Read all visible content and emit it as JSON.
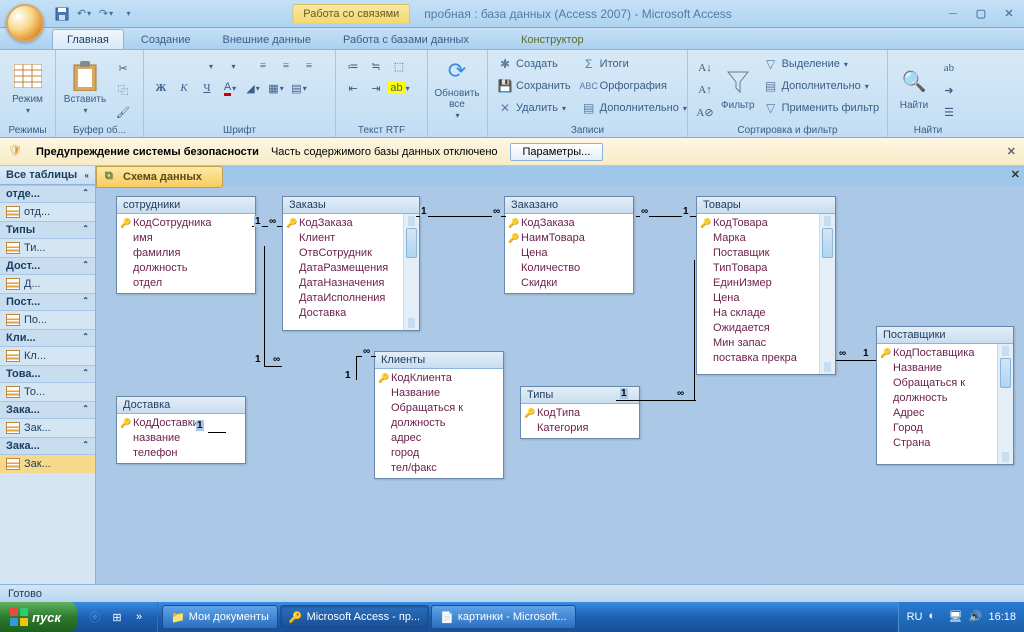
{
  "title": {
    "context_tab": "Работа со связями",
    "app": "пробная : база данных (Access 2007) - Microsoft Access"
  },
  "ribbon_tabs": [
    "Главная",
    "Создание",
    "Внешние данные",
    "Работа с базами данных",
    "Конструктор"
  ],
  "ribbon": {
    "groups": {
      "rezhimy": "Режимы",
      "bufer": "Буфер об...",
      "shrift": "Шрифт",
      "text_rtf": "Текст RTF",
      "zapisi_lbl": "Записи",
      "sort_filter": "Сортировка и фильтр",
      "nayti_lbl": "Найти"
    },
    "rezhim": "Режим",
    "vstavit": "Вставить",
    "obnovit": "Обновить\nвсе",
    "zapisi": {
      "sozdat": "Создать",
      "sokhranit": "Сохранить",
      "udalit": "Удалить",
      "itogi": "Итоги",
      "orfografiya": "Орфография",
      "dop": "Дополнительно"
    },
    "sort": {
      "filtr": "Фильтр",
      "vydelenie": "Выделение",
      "dop": "Дополнительно",
      "primenit": "Применить фильтр"
    },
    "nayti": "Найти"
  },
  "security": {
    "title": "Предупреждение системы безопасности",
    "msg": "Часть содержимого базы данных отключено",
    "btn": "Параметры..."
  },
  "nav": {
    "header": "Все таблицы",
    "groups": [
      {
        "h": "отде...",
        "items": [
          "отд..."
        ]
      },
      {
        "h": "Типы",
        "items": [
          "Ти..."
        ]
      },
      {
        "h": "Дост...",
        "items": [
          "Д..."
        ]
      },
      {
        "h": "Пост...",
        "items": [
          "По..."
        ]
      },
      {
        "h": "Кли...",
        "items": [
          "Кл..."
        ]
      },
      {
        "h": "Това...",
        "items": [
          "То..."
        ]
      },
      {
        "h": "Зака...",
        "items": [
          "Зак..."
        ]
      },
      {
        "h": "Зака...",
        "items": [
          "Зак..."
        ],
        "selected": true
      }
    ]
  },
  "doc_tab": "Схема данных",
  "tables": {
    "sotrudniki": {
      "title": "сотрудники",
      "key": "КодСотрудника",
      "fields": [
        "имя",
        "фамилия",
        "должность",
        "отдел"
      ]
    },
    "zakazy": {
      "title": "Заказы",
      "key": "КодЗаказа",
      "fields": [
        "Клиент",
        "ОтвСотрудник",
        "ДатаРазмещения",
        "ДатаНазначения",
        "ДатаИсполнения",
        "Доставка"
      ],
      "scroll": true
    },
    "zakazano": {
      "title": "Заказано",
      "keys": [
        "КодЗаказа",
        "НаимТовара"
      ],
      "fields": [
        "Цена",
        "Количество",
        "Скидки"
      ]
    },
    "tovary": {
      "title": "Товары",
      "key": "КодТовара",
      "fields": [
        "Марка",
        "Поставщик",
        "ТипТовара",
        "ЕдинИзмер",
        "Цена",
        "На складе",
        "Ожидается",
        "Мин запас",
        "поставка прекра"
      ],
      "scroll": true
    },
    "klienty": {
      "title": "Клиенты",
      "key": "КодКлиента",
      "fields": [
        "Название",
        "Обращаться к",
        "должность",
        "адрес",
        "город",
        "тел/факс"
      ]
    },
    "dostavka": {
      "title": "Доставка",
      "key": "КодДоставки",
      "fields": [
        "название",
        "телефон"
      ]
    },
    "tipy": {
      "title": "Типы",
      "key": "КодТипа",
      "fields": [
        "Категория"
      ]
    },
    "postavshchiki": {
      "title": "Поставщики",
      "key": "КодПоставщика",
      "fields": [
        "Название",
        "Обращаться к",
        "должность",
        "Адрес",
        "Город",
        "Страна"
      ],
      "scroll": true
    }
  },
  "rel_one": "1",
  "rel_many": "∞",
  "status": "Готово",
  "taskbar": {
    "start": "пуск",
    "tasks": [
      "Мои документы",
      "Microsoft Access - пр...",
      "картинки - Microsoft..."
    ],
    "lang": "RU",
    "time": "16:18"
  }
}
